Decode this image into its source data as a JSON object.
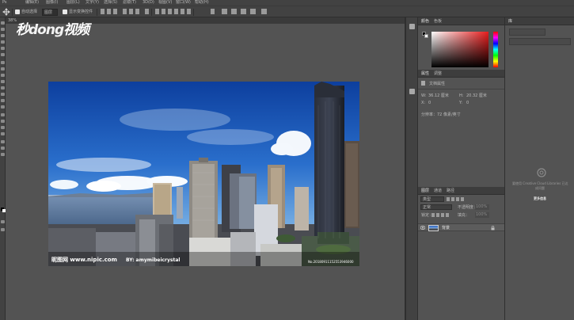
{
  "menubar": {
    "items": [
      "",
      "编辑(E)",
      "图像(I)",
      "图层(L)",
      "文字(Y)",
      "选择(S)",
      "滤镜(T)",
      "3D(D)",
      "视图(V)",
      "窗口(W)",
      "帮助(H)"
    ]
  },
  "options": {
    "auto_select": "自动选择",
    "auto_select_target": "图层",
    "show_transform": "显示变换控件"
  },
  "document": {
    "tab_label": "38%"
  },
  "watermark": {
    "logo_prefix": "秒",
    "logo_mid": "dong",
    "logo_suffix": "视频",
    "nipic": "昵图网 www.nipic.com",
    "author": "BY: amymibeicrystal",
    "code": "No.20180911152553946000"
  },
  "color_panel": {
    "tab_color": "颜色",
    "tab_swatches": "色板"
  },
  "properties_panel": {
    "tab_properties": "属性",
    "tab_adjustments": "调整",
    "doc_label": "文档属性",
    "w_label": "W:",
    "w_value": "36.12 厘米",
    "h_label": "H:",
    "h_value": "20.32 厘米",
    "x_label": "X:",
    "x_value": "0",
    "y_label": "Y:",
    "y_value": "0",
    "resolution": "分辨率：72 像素/英寸"
  },
  "layers_panel": {
    "tab_layers": "图层",
    "tab_channels": "通道",
    "tab_paths": "路径",
    "kind_label": "类型",
    "mode_label": "正常",
    "opacity_label": "不透明度：",
    "opacity_value": "100%",
    "lock_label": "锁定：",
    "fill_label": "填充：",
    "fill_value": "100%",
    "layer_name": "背景"
  },
  "libraries_panel": {
    "tab": "库",
    "search_placeholder": "",
    "message": "要使用 Creative Cloud Libraries 已达",
    "message2": "成问题",
    "link": "更多信息"
  }
}
